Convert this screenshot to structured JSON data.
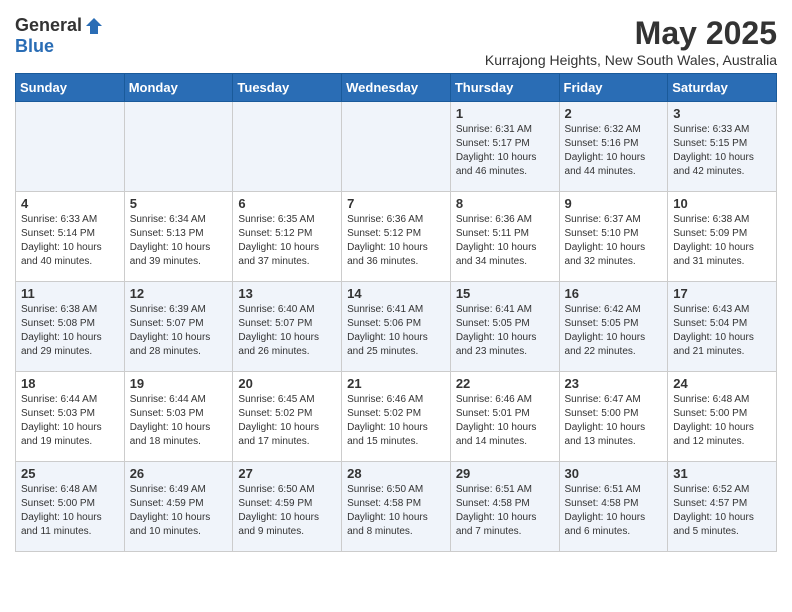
{
  "logo": {
    "general": "General",
    "blue": "Blue"
  },
  "title": {
    "month_year": "May 2025",
    "location": "Kurrajong Heights, New South Wales, Australia"
  },
  "weekdays": [
    "Sunday",
    "Monday",
    "Tuesday",
    "Wednesday",
    "Thursday",
    "Friday",
    "Saturday"
  ],
  "weeks": [
    [
      {
        "day": "",
        "info": ""
      },
      {
        "day": "",
        "info": ""
      },
      {
        "day": "",
        "info": ""
      },
      {
        "day": "",
        "info": ""
      },
      {
        "day": "1",
        "info": "Sunrise: 6:31 AM\nSunset: 5:17 PM\nDaylight: 10 hours\nand 46 minutes."
      },
      {
        "day": "2",
        "info": "Sunrise: 6:32 AM\nSunset: 5:16 PM\nDaylight: 10 hours\nand 44 minutes."
      },
      {
        "day": "3",
        "info": "Sunrise: 6:33 AM\nSunset: 5:15 PM\nDaylight: 10 hours\nand 42 minutes."
      }
    ],
    [
      {
        "day": "4",
        "info": "Sunrise: 6:33 AM\nSunset: 5:14 PM\nDaylight: 10 hours\nand 40 minutes."
      },
      {
        "day": "5",
        "info": "Sunrise: 6:34 AM\nSunset: 5:13 PM\nDaylight: 10 hours\nand 39 minutes."
      },
      {
        "day": "6",
        "info": "Sunrise: 6:35 AM\nSunset: 5:12 PM\nDaylight: 10 hours\nand 37 minutes."
      },
      {
        "day": "7",
        "info": "Sunrise: 6:36 AM\nSunset: 5:12 PM\nDaylight: 10 hours\nand 36 minutes."
      },
      {
        "day": "8",
        "info": "Sunrise: 6:36 AM\nSunset: 5:11 PM\nDaylight: 10 hours\nand 34 minutes."
      },
      {
        "day": "9",
        "info": "Sunrise: 6:37 AM\nSunset: 5:10 PM\nDaylight: 10 hours\nand 32 minutes."
      },
      {
        "day": "10",
        "info": "Sunrise: 6:38 AM\nSunset: 5:09 PM\nDaylight: 10 hours\nand 31 minutes."
      }
    ],
    [
      {
        "day": "11",
        "info": "Sunrise: 6:38 AM\nSunset: 5:08 PM\nDaylight: 10 hours\nand 29 minutes."
      },
      {
        "day": "12",
        "info": "Sunrise: 6:39 AM\nSunset: 5:07 PM\nDaylight: 10 hours\nand 28 minutes."
      },
      {
        "day": "13",
        "info": "Sunrise: 6:40 AM\nSunset: 5:07 PM\nDaylight: 10 hours\nand 26 minutes."
      },
      {
        "day": "14",
        "info": "Sunrise: 6:41 AM\nSunset: 5:06 PM\nDaylight: 10 hours\nand 25 minutes."
      },
      {
        "day": "15",
        "info": "Sunrise: 6:41 AM\nSunset: 5:05 PM\nDaylight: 10 hours\nand 23 minutes."
      },
      {
        "day": "16",
        "info": "Sunrise: 6:42 AM\nSunset: 5:05 PM\nDaylight: 10 hours\nand 22 minutes."
      },
      {
        "day": "17",
        "info": "Sunrise: 6:43 AM\nSunset: 5:04 PM\nDaylight: 10 hours\nand 21 minutes."
      }
    ],
    [
      {
        "day": "18",
        "info": "Sunrise: 6:44 AM\nSunset: 5:03 PM\nDaylight: 10 hours\nand 19 minutes."
      },
      {
        "day": "19",
        "info": "Sunrise: 6:44 AM\nSunset: 5:03 PM\nDaylight: 10 hours\nand 18 minutes."
      },
      {
        "day": "20",
        "info": "Sunrise: 6:45 AM\nSunset: 5:02 PM\nDaylight: 10 hours\nand 17 minutes."
      },
      {
        "day": "21",
        "info": "Sunrise: 6:46 AM\nSunset: 5:02 PM\nDaylight: 10 hours\nand 15 minutes."
      },
      {
        "day": "22",
        "info": "Sunrise: 6:46 AM\nSunset: 5:01 PM\nDaylight: 10 hours\nand 14 minutes."
      },
      {
        "day": "23",
        "info": "Sunrise: 6:47 AM\nSunset: 5:00 PM\nDaylight: 10 hours\nand 13 minutes."
      },
      {
        "day": "24",
        "info": "Sunrise: 6:48 AM\nSunset: 5:00 PM\nDaylight: 10 hours\nand 12 minutes."
      }
    ],
    [
      {
        "day": "25",
        "info": "Sunrise: 6:48 AM\nSunset: 5:00 PM\nDaylight: 10 hours\nand 11 minutes."
      },
      {
        "day": "26",
        "info": "Sunrise: 6:49 AM\nSunset: 4:59 PM\nDaylight: 10 hours\nand 10 minutes."
      },
      {
        "day": "27",
        "info": "Sunrise: 6:50 AM\nSunset: 4:59 PM\nDaylight: 10 hours\nand 9 minutes."
      },
      {
        "day": "28",
        "info": "Sunrise: 6:50 AM\nSunset: 4:58 PM\nDaylight: 10 hours\nand 8 minutes."
      },
      {
        "day": "29",
        "info": "Sunrise: 6:51 AM\nSunset: 4:58 PM\nDaylight: 10 hours\nand 7 minutes."
      },
      {
        "day": "30",
        "info": "Sunrise: 6:51 AM\nSunset: 4:58 PM\nDaylight: 10 hours\nand 6 minutes."
      },
      {
        "day": "31",
        "info": "Sunrise: 6:52 AM\nSunset: 4:57 PM\nDaylight: 10 hours\nand 5 minutes."
      }
    ]
  ]
}
